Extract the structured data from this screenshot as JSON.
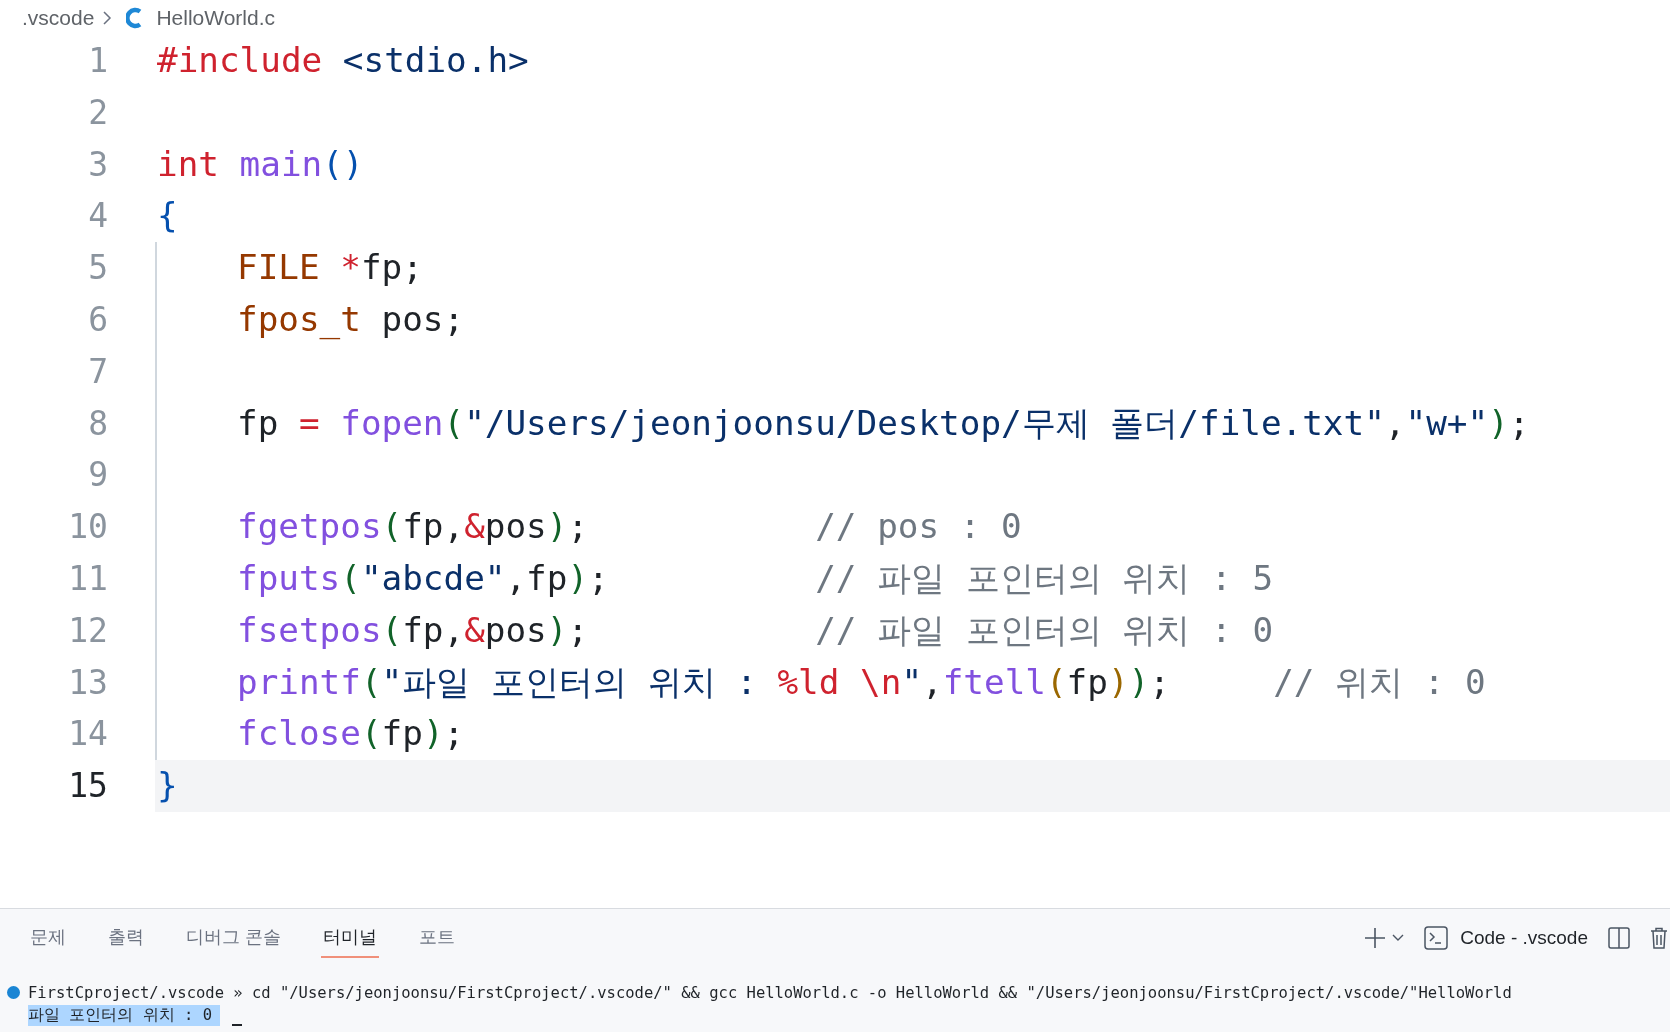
{
  "breadcrumb": {
    "folder": ".vscode",
    "file": "HelloWorld.c"
  },
  "editor": {
    "lines": [
      {
        "number": "1",
        "indented": false,
        "current": false,
        "tokens": [
          {
            "kind": "preproc",
            "text": "#include "
          },
          {
            "kind": "string",
            "text": "<stdio.h>"
          }
        ]
      },
      {
        "number": "2",
        "indented": false,
        "current": false
      },
      {
        "number": "3",
        "indented": false,
        "current": false,
        "tokens": [
          {
            "kind": "keyword",
            "text": "int "
          },
          {
            "kind": "func",
            "text": "main"
          },
          {
            "kind": "brace",
            "text": "()"
          }
        ]
      },
      {
        "number": "4",
        "indented": false,
        "current": false,
        "tokens": [
          {
            "kind": "brace",
            "text": "{"
          }
        ]
      },
      {
        "number": "5",
        "indented": true,
        "current": false,
        "tokens": [
          {
            "kind": "type",
            "text": "FILE "
          },
          {
            "kind": "op",
            "text": "*"
          },
          {
            "kind": "plain",
            "text": "fp;"
          }
        ]
      },
      {
        "number": "6",
        "indented": true,
        "current": false,
        "tokens": [
          {
            "kind": "type",
            "text": "fpos_t"
          },
          {
            "kind": "plain",
            "text": " pos;"
          }
        ]
      },
      {
        "number": "7",
        "indented": true,
        "current": false
      },
      {
        "number": "8",
        "indented": true,
        "current": false,
        "tokens": [
          {
            "kind": "plain",
            "text": "fp "
          },
          {
            "kind": "op",
            "text": "= "
          },
          {
            "kind": "func",
            "text": "fopen"
          },
          {
            "kind": "paren",
            "text": "("
          },
          {
            "kind": "string",
            "text": "\"/Users/jeonjoonsu/Desktop/무제 폴더/file.txt\""
          },
          {
            "kind": "plain",
            "text": ","
          },
          {
            "kind": "string",
            "text": "\"w+\""
          },
          {
            "kind": "paren",
            "text": ")"
          },
          {
            "kind": "plain",
            "text": ";"
          }
        ]
      },
      {
        "number": "9",
        "indented": true,
        "current": false
      },
      {
        "number": "10",
        "indented": true,
        "current": false,
        "tokens": [
          {
            "kind": "func",
            "text": "fgetpos"
          },
          {
            "kind": "paren",
            "text": "("
          },
          {
            "kind": "plain",
            "text": "fp,"
          },
          {
            "kind": "op",
            "text": "&"
          },
          {
            "kind": "plain",
            "text": "pos"
          },
          {
            "kind": "paren",
            "text": ")"
          },
          {
            "kind": "plain",
            "text": ";           "
          },
          {
            "kind": "comment",
            "text": "// pos : 0"
          }
        ]
      },
      {
        "number": "11",
        "indented": true,
        "current": false,
        "tokens": [
          {
            "kind": "func",
            "text": "fputs"
          },
          {
            "kind": "paren",
            "text": "("
          },
          {
            "kind": "string",
            "text": "\"abcde\""
          },
          {
            "kind": "plain",
            "text": ",fp"
          },
          {
            "kind": "paren",
            "text": ")"
          },
          {
            "kind": "plain",
            "text": ";          "
          },
          {
            "kind": "comment",
            "text": "// 파일 포인터의 위치 : 5"
          }
        ]
      },
      {
        "number": "12",
        "indented": true,
        "current": false,
        "tokens": [
          {
            "kind": "func",
            "text": "fsetpos"
          },
          {
            "kind": "paren",
            "text": "("
          },
          {
            "kind": "plain",
            "text": "fp,"
          },
          {
            "kind": "op",
            "text": "&"
          },
          {
            "kind": "plain",
            "text": "pos"
          },
          {
            "kind": "paren",
            "text": ")"
          },
          {
            "kind": "plain",
            "text": ";           "
          },
          {
            "kind": "comment",
            "text": "// 파일 포인터의 위치 : 0"
          }
        ]
      },
      {
        "number": "13",
        "indented": true,
        "current": false,
        "tokens": [
          {
            "kind": "func",
            "text": "printf"
          },
          {
            "kind": "paren",
            "text": "("
          },
          {
            "kind": "string",
            "text": "\"파일 포인터의 위치 : "
          },
          {
            "kind": "escape",
            "text": "%ld \\n"
          },
          {
            "kind": "string",
            "text": "\""
          },
          {
            "kind": "plain",
            "text": ","
          },
          {
            "kind": "func",
            "text": "ftell"
          },
          {
            "kind": "paren2",
            "text": "("
          },
          {
            "kind": "plain",
            "text": "fp"
          },
          {
            "kind": "paren2",
            "text": ")"
          },
          {
            "kind": "paren",
            "text": ")"
          },
          {
            "kind": "plain",
            "text": ";     "
          },
          {
            "kind": "comment",
            "text": "// 위치 : 0"
          }
        ]
      },
      {
        "number": "14",
        "indented": true,
        "current": false,
        "tokens": [
          {
            "kind": "func",
            "text": "fclose"
          },
          {
            "kind": "paren",
            "text": "("
          },
          {
            "kind": "plain",
            "text": "fp"
          },
          {
            "kind": "paren",
            "text": ")"
          },
          {
            "kind": "plain",
            "text": ";"
          }
        ]
      },
      {
        "number": "15",
        "indented": false,
        "current": true,
        "tokens": [
          {
            "kind": "brace",
            "text": "}"
          }
        ]
      }
    ]
  },
  "panel": {
    "tabs": [
      {
        "label": "문제",
        "selected": false
      },
      {
        "label": "출력",
        "selected": false
      },
      {
        "label": "디버그 콘솔",
        "selected": false
      },
      {
        "label": "터미널",
        "selected": true
      },
      {
        "label": "포트",
        "selected": false
      }
    ],
    "terminal_name": "Code - .vscode",
    "terminal": {
      "command": "FirstCproject/.vscode » cd \"/Users/jeonjoonsu/FirstCproject/.vscode/\" && gcc HelloWorld.c -o HelloWorld && \"/Users/jeonjoonsu/FirstCproject/.vscode/\"HelloWorld",
      "output": "파일 포인터의 위치 : 0"
    }
  }
}
